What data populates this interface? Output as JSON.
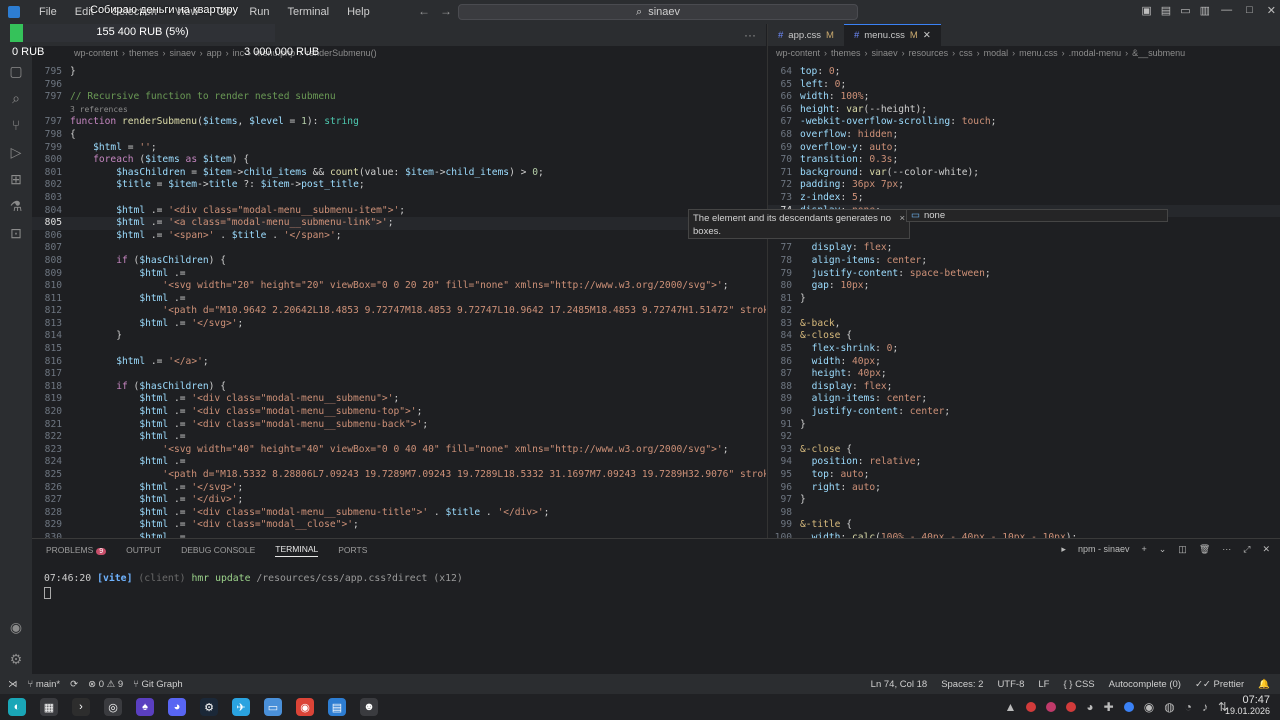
{
  "titlebar": {
    "menu": [
      "File",
      "Edit",
      "Selection",
      "View",
      "Go",
      "Run",
      "Terminal",
      "Help"
    ],
    "search": "sinaev",
    "goal_overlay": "Собираю деньги на квартиру"
  },
  "goal": {
    "progress_text": "155 400 RUB (5%)",
    "progress_fraction": 0.05,
    "start": "0 RUB",
    "target": "3 000 000 RUB",
    "fill_color": "#35c25a"
  },
  "left_editor": {
    "breadcrumb": [
      "wp-content",
      "themes",
      "sinaev",
      "app",
      "inc",
      "menu.php",
      "renderSubmenu()"
    ],
    "lines": [
      {
        "no": "795",
        "html": "}"
      },
      {
        "no": "796",
        "html": ""
      },
      {
        "no": "797",
        "html": "<span class='c-com'>// Recursive function to render nested submenu</span>"
      },
      {
        "no": "",
        "html": "<span class='c-ref'>3 references</span>"
      },
      {
        "no": "797",
        "html": "<span class='c-kw'>function</span> <span class='c-fn'>renderSubmenu</span>(<span class='c-var'>$items</span>, <span class='c-var'>$level</span> = <span class='c-num'>1</span>): <span class='c-ty'>string</span>"
      },
      {
        "no": "798",
        "html": "{"
      },
      {
        "no": "799",
        "html": "    <span class='c-var'>$html</span> = <span class='c-str'>''</span>;"
      },
      {
        "no": "800",
        "html": "    <span class='c-kw'>foreach</span> (<span class='c-var'>$items</span> <span class='c-kw'>as</span> <span class='c-var'>$item</span>) {"
      },
      {
        "no": "801",
        "html": "        <span class='c-var'>$hasChildren</span> = <span class='c-var'>$item</span>-><span class='c-var'>child_items</span> && <span class='c-fn'>count</span>(value: <span class='c-var'>$item</span>-><span class='c-var'>child_items</span>) > <span class='c-num'>0</span>;"
      },
      {
        "no": "802",
        "html": "        <span class='c-var'>$title</span> = <span class='c-var'>$item</span>-><span class='c-var'>title</span> ?: <span class='c-var'>$item</span>-><span class='c-var'>post_title</span>;"
      },
      {
        "no": "803",
        "html": ""
      },
      {
        "no": "804",
        "html": "        <span class='c-var'>$html</span> .= <span class='c-str'>'&lt;div class=\"modal-menu__submenu-item\"&gt;'</span>;"
      },
      {
        "no": "805",
        "html": "        <span class='c-var'>$html</span> .= <span class='c-str'>'&lt;a class=\"modal-menu__submenu-link\"&gt;'</span>;",
        "cur": true
      },
      {
        "no": "806",
        "html": "        <span class='c-var'>$html</span> .= <span class='c-str'>'&lt;span&gt;'</span> . <span class='c-var'>$title</span> . <span class='c-str'>'&lt;/span&gt;'</span>;"
      },
      {
        "no": "807",
        "html": ""
      },
      {
        "no": "808",
        "html": "        <span class='c-kw'>if</span> (<span class='c-var'>$hasChildren</span>) {"
      },
      {
        "no": "809",
        "html": "            <span class='c-var'>$html</span> .="
      },
      {
        "no": "810",
        "html": "                <span class='c-str'>'&lt;svg width=\"20\" height=\"20\" viewBox=\"0 0 20 20\" fill=\"none\" xmlns=\"http://www.w3.org/2000/svg\"&gt;'</span>;"
      },
      {
        "no": "811",
        "html": "            <span class='c-var'>$html</span> .="
      },
      {
        "no": "812",
        "html": "                <span class='c-str'>'&lt;path d=\"M10.9642 2.20642L18.4853 9.72747M18.4853 9.72747L10.9642 17.2485M18.4853 9.72747H1.51472\" stroke=</span>"
      },
      {
        "no": "813",
        "html": "            <span class='c-var'>$html</span> .= <span class='c-str'>'&lt;/svg&gt;'</span>;"
      },
      {
        "no": "814",
        "html": "        }"
      },
      {
        "no": "815",
        "html": ""
      },
      {
        "no": "816",
        "html": "        <span class='c-var'>$html</span> .= <span class='c-str'>'&lt;/a&gt;'</span>;"
      },
      {
        "no": "817",
        "html": ""
      },
      {
        "no": "818",
        "html": "        <span class='c-kw'>if</span> (<span class='c-var'>$hasChildren</span>) {"
      },
      {
        "no": "819",
        "html": "            <span class='c-var'>$html</span> .= <span class='c-str'>'&lt;div class=\"modal-menu__submenu\"&gt;'</span>;"
      },
      {
        "no": "820",
        "html": "            <span class='c-var'>$html</span> .= <span class='c-str'>'&lt;div class=\"modal-menu__submenu-top\"&gt;'</span>;"
      },
      {
        "no": "821",
        "html": "            <span class='c-var'>$html</span> .= <span class='c-str'>'&lt;div class=\"modal-menu__submenu-back\"&gt;'</span>;"
      },
      {
        "no": "822",
        "html": "            <span class='c-var'>$html</span> .="
      },
      {
        "no": "823",
        "html": "                <span class='c-str'>'&lt;svg width=\"40\" height=\"40\" viewBox=\"0 0 40 40\" fill=\"none\" xmlns=\"http://www.w3.org/2000/svg\"&gt;'</span>;"
      },
      {
        "no": "824",
        "html": "            <span class='c-var'>$html</span> .="
      },
      {
        "no": "825",
        "html": "                <span class='c-str'>'&lt;path d=\"M18.5332 8.28806L7.09243 19.7289M7.09243 19.7289L18.5332 31.1697M7.09243 19.7289H32.9076\" stroke=</span>"
      },
      {
        "no": "826",
        "html": "            <span class='c-var'>$html</span> .= <span class='c-str'>'&lt;/svg&gt;'</span>;"
      },
      {
        "no": "827",
        "html": "            <span class='c-var'>$html</span> .= <span class='c-str'>'&lt;/div&gt;'</span>;"
      },
      {
        "no": "828",
        "html": "            <span class='c-var'>$html</span> .= <span class='c-str'>'&lt;div class=\"modal-menu__submenu-title\"&gt;'</span> . <span class='c-var'>$title</span> . <span class='c-str'>'&lt;/div&gt;'</span>;"
      },
      {
        "no": "829",
        "html": "            <span class='c-var'>$html</span> .= <span class='c-str'>'&lt;div class=\"modal__close\"&gt;'</span>;"
      },
      {
        "no": "830",
        "html": "            <span class='c-var'>$html</span> .="
      }
    ]
  },
  "right_editor": {
    "tabs": [
      {
        "label": "app.css",
        "mod": "M",
        "active": false
      },
      {
        "label": "menu.css",
        "mod": "M",
        "active": true
      }
    ],
    "breadcrumb": [
      "wp-content",
      "themes",
      "sinaev",
      "resources",
      "css",
      "modal",
      "menu.css",
      ".modal-menu",
      "&__submenu"
    ],
    "lines": [
      {
        "no": "64",
        "html": "<span class='c-prop'>top</span>: <span class='c-val'>0</span>;"
      },
      {
        "no": "65",
        "html": "<span class='c-prop'>left</span>: <span class='c-val'>0</span>;"
      },
      {
        "no": "66",
        "html": "<span class='c-prop'>width</span>: <span class='c-val'>100%</span>;"
      },
      {
        "no": "66",
        "html": "<span class='c-prop'>height</span>: <span class='c-fn'>var</span>(--height);"
      },
      {
        "no": "67",
        "html": "<span class='c-prop'>-webkit-overflow-scrolling</span>: <span class='c-val'>touch</span>;"
      },
      {
        "no": "68",
        "html": "<span class='c-prop'>overflow</span>: <span class='c-val'>hidden</span>;"
      },
      {
        "no": "69",
        "html": "<span class='c-prop'>overflow-y</span>: <span class='c-val'>auto</span>;"
      },
      {
        "no": "70",
        "html": "<span class='c-prop'>transition</span>: <span class='c-val'>0.3s</span>;"
      },
      {
        "no": "71",
        "html": "<span class='c-prop'>background</span>: <span class='c-fn'>var</span>(--color-white);"
      },
      {
        "no": "72",
        "html": "<span class='c-prop'>padding</span>: <span class='c-val'>36px 7px</span>;"
      },
      {
        "no": "73",
        "html": "<span class='c-prop'>z-index</span>: <span class='c-val'>5</span>;"
      },
      {
        "no": "74",
        "html": "<span class='c-prop'>display</span>: <span class='c-val'>none</span>;",
        "cur": true
      },
      {
        "no": "75",
        "html": ""
      },
      {
        "no": "76",
        "html": ""
      },
      {
        "no": "77",
        "html": "  <span class='c-prop'>display</span>: <span class='c-val'>flex</span>;"
      },
      {
        "no": "78",
        "html": "  <span class='c-prop'>align-items</span>: <span class='c-val'>center</span>;"
      },
      {
        "no": "79",
        "html": "  <span class='c-prop'>justify-content</span>: <span class='c-val'>space-between</span>;"
      },
      {
        "no": "80",
        "html": "  <span class='c-prop'>gap</span>: <span class='c-val'>10px</span>;"
      },
      {
        "no": "81",
        "html": "}"
      },
      {
        "no": "82",
        "html": ""
      },
      {
        "no": "83",
        "html": "<span class='c-sel'>&-back</span>,"
      },
      {
        "no": "84",
        "html": "<span class='c-sel'>&-close</span> {"
      },
      {
        "no": "85",
        "html": "  <span class='c-prop'>flex-shrink</span>: <span class='c-val'>0</span>;"
      },
      {
        "no": "86",
        "html": "  <span class='c-prop'>width</span>: <span class='c-val'>40px</span>;"
      },
      {
        "no": "87",
        "html": "  <span class='c-prop'>height</span>: <span class='c-val'>40px</span>;"
      },
      {
        "no": "88",
        "html": "  <span class='c-prop'>display</span>: <span class='c-val'>flex</span>;"
      },
      {
        "no": "89",
        "html": "  <span class='c-prop'>align-items</span>: <span class='c-val'>center</span>;"
      },
      {
        "no": "90",
        "html": "  <span class='c-prop'>justify-content</span>: <span class='c-val'>center</span>;"
      },
      {
        "no": "91",
        "html": "}"
      },
      {
        "no": "92",
        "html": ""
      },
      {
        "no": "93",
        "html": "<span class='c-sel'>&-close</span> {"
      },
      {
        "no": "94",
        "html": "  <span class='c-prop'>position</span>: <span class='c-val'>relative</span>;"
      },
      {
        "no": "95",
        "html": "  <span class='c-prop'>top</span>: <span class='c-val'>auto</span>;"
      },
      {
        "no": "96",
        "html": "  <span class='c-prop'>right</span>: <span class='c-val'>auto</span>;"
      },
      {
        "no": "97",
        "html": "}"
      },
      {
        "no": "98",
        "html": ""
      },
      {
        "no": "99",
        "html": "<span class='c-sel'>&-title</span> {"
      },
      {
        "no": "100",
        "html": "  <span class='c-prop'>width</span>: <span class='c-fn'>calc</span>(<span class='c-val'>100% - 40px - 40px - 10px - 10px</span>);"
      }
    ],
    "hover_text": "The element and its descendants generates no boxes.",
    "suggest": "none"
  },
  "panel": {
    "tabs": [
      "PROBLEMS",
      "OUTPUT",
      "DEBUG CONSOLE",
      "TERMINAL",
      "PORTS"
    ],
    "problems_count": "9",
    "active_tab": "TERMINAL",
    "term_name": "npm - sinaev",
    "terminal": {
      "time": "07:46:20",
      "tag": "[vite]",
      "client": "(client)",
      "cmd": "hmr update",
      "path": "/resources/css/app.css?direct",
      "count": "(x12)"
    }
  },
  "statusbar": {
    "branch": "main*",
    "errors": "0",
    "warnings": "9",
    "git_graph": "Git Graph",
    "position": "Ln 74, Col 18",
    "spaces": "Spaces: 2",
    "encoding": "UTF-8",
    "eol": "LF",
    "language": "CSS",
    "autocomplete": "Autocomplete (0)",
    "prettier": "Prettier"
  },
  "taskbar": {
    "time": "07:47",
    "date": "19.01.2026"
  }
}
